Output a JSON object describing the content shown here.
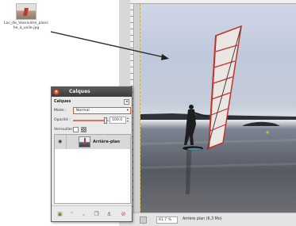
{
  "desktop": {
    "file_label": "Lac_de_Vassivière_planche_à_voile.jpg"
  },
  "image_window": {
    "zoom": "61.7 %",
    "status_text": "Arrière plan (6,3 Mo)"
  },
  "layers_dialog": {
    "title": "Calques",
    "header_label": "Calques",
    "mode_label": "Mode :",
    "mode_value": "Normal",
    "opacity_label": "Opacité :",
    "opacity_value": "100,0",
    "opacity_percent": 100,
    "lock_label": "Verrouiller :",
    "layer_name": "Arrière-plan"
  },
  "colors": {
    "titlebar": "#3c3c3c",
    "accent": "#d05d35",
    "close": "#e2542a",
    "guide": "#c9b84a"
  },
  "icons": {
    "footer": [
      "new-layer-icon",
      "raise-layer-icon",
      "lower-layer-icon",
      "duplicate-layer-icon",
      "anchor-layer-icon",
      "delete-layer-icon"
    ]
  }
}
